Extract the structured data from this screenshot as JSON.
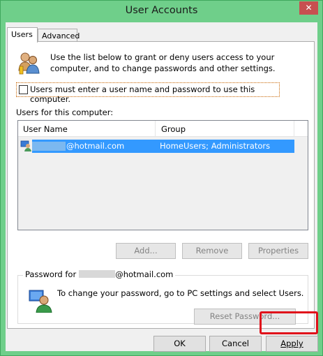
{
  "window": {
    "title": "User Accounts",
    "close_glyph": "✕"
  },
  "tabs": [
    {
      "label": "Users"
    },
    {
      "label": "Advanced"
    }
  ],
  "intro_text": "Use the list below to grant or deny users access to your computer, and to change passwords and other settings.",
  "require_login": {
    "label": "Users must enter a user name and password to use this computer.",
    "checked": false
  },
  "users_list": {
    "label": "Users for this computer:",
    "columns": [
      "User Name",
      "Group"
    ],
    "rows": [
      {
        "user_name": "@hotmail.com",
        "group": "HomeUsers; Administrators",
        "selected": true
      }
    ]
  },
  "list_buttons": {
    "add": "Add...",
    "remove": "Remove",
    "properties": "Properties"
  },
  "password_group": {
    "legend_prefix": "Password for",
    "legend_suffix": "@hotmail.com",
    "text": "To change your password, go to PC settings and select Users.",
    "reset_button": "Reset Password..."
  },
  "dialog_buttons": {
    "ok": "OK",
    "cancel": "Cancel",
    "apply": "Apply"
  },
  "colors": {
    "title_bar": "#6fcf8a",
    "selection": "#3399ff",
    "highlight": "#e0101a"
  }
}
